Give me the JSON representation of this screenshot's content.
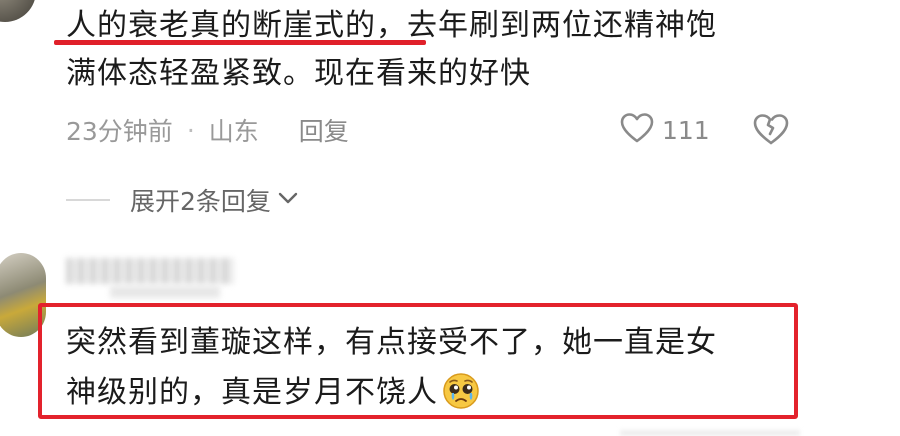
{
  "comment1": {
    "text_line1": "人的衰老真的断崖式的，去年刷到两位还精神饱",
    "text_line2": "满体态轻盈紧致。现在看来的好快",
    "time": "23分钟前",
    "separator": "·",
    "location": "山东",
    "reply_label": "回复",
    "like_count": "111",
    "expand_label": "展开2条回复"
  },
  "comment2": {
    "text_line1": "突然看到董璇这样，有点接受不了，她一直是女",
    "text_line2": "神级别的，真是岁月不饶人"
  },
  "colors": {
    "highlight_red": "#e3222c",
    "meta_gray": "#999999"
  },
  "icons": {
    "like": "heart-outline-icon",
    "dislike": "broken-heart-icon",
    "expand": "chevron-down-icon",
    "emoji": "pleading-face-emoji"
  }
}
